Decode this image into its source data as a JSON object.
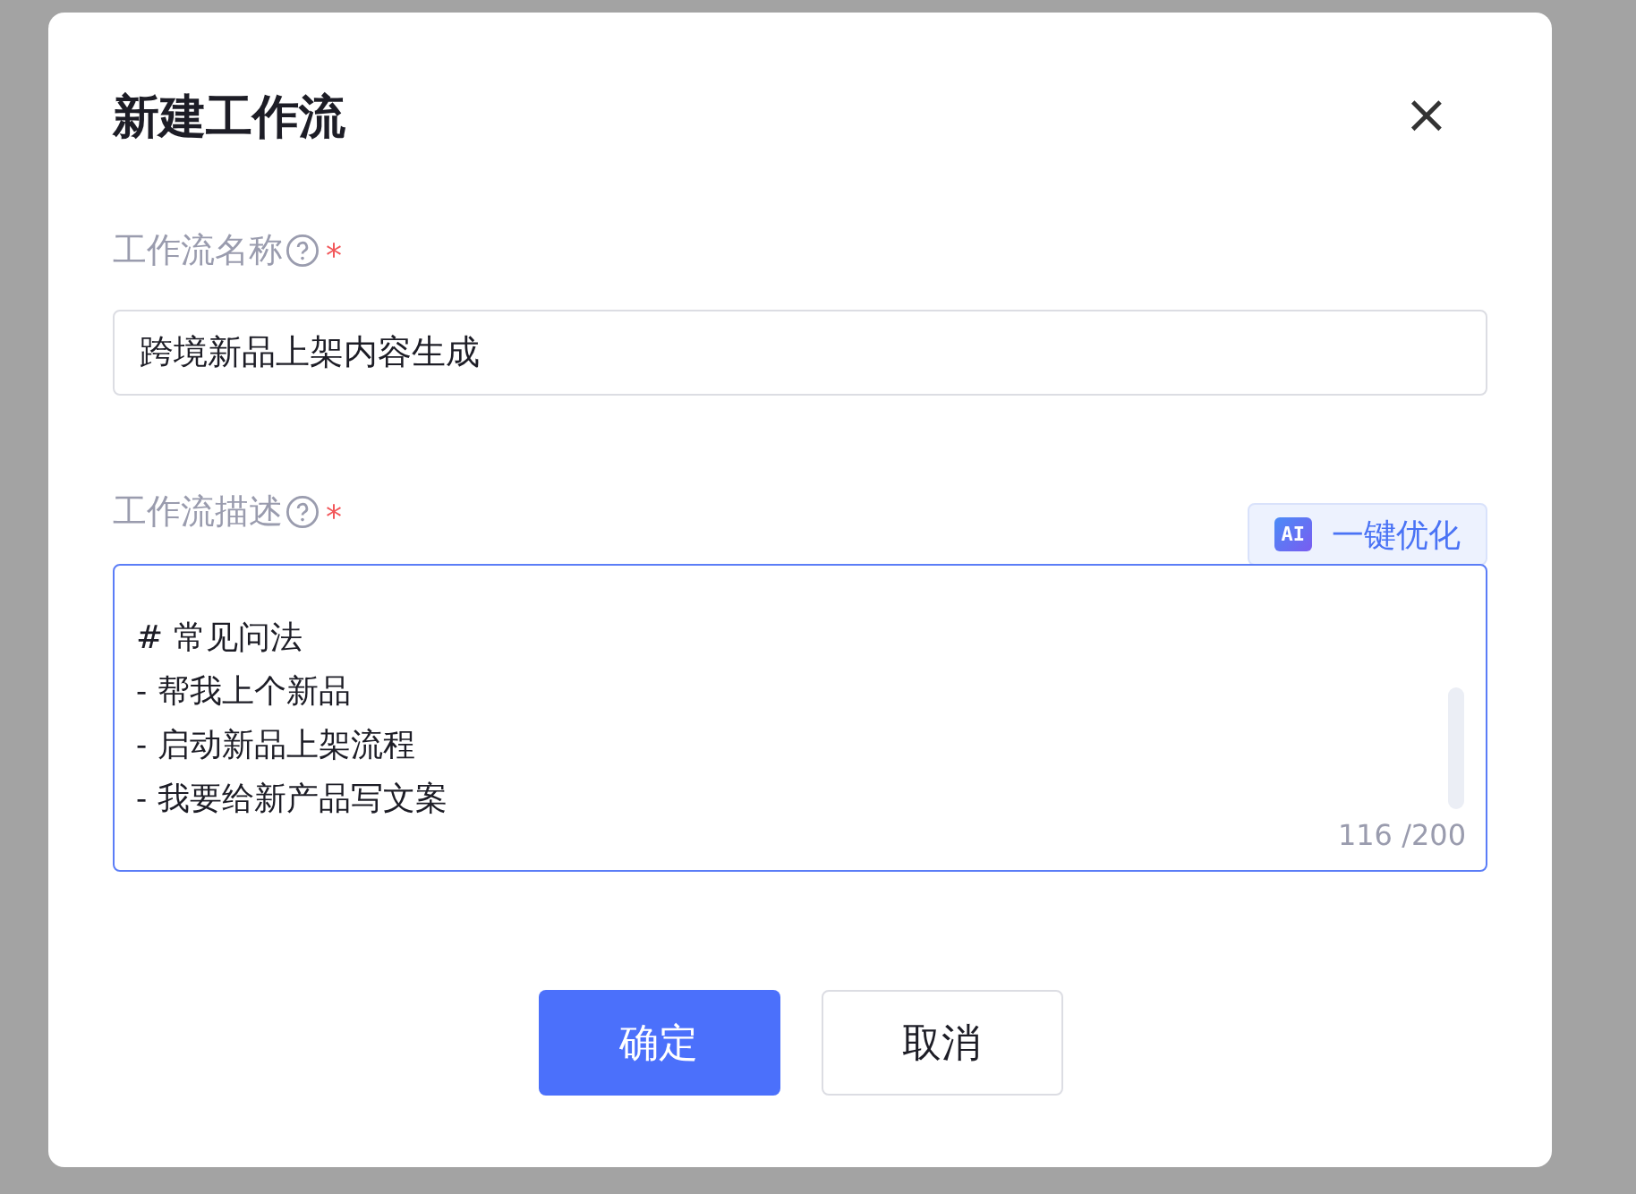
{
  "dialog": {
    "title": "新建工作流",
    "close": "×"
  },
  "name_field": {
    "label": "工作流名称",
    "required": "*",
    "value": "跨境新品上架内容生成"
  },
  "description_field": {
    "label": "工作流描述",
    "required": "*",
    "optimize_button": {
      "badge": "AI",
      "label": "一键优化"
    },
    "value_lines": [
      "# 常见问法",
      "- 帮我上个新品",
      "- 启动新品上架流程",
      "- 我要给新产品写文案"
    ],
    "counter": "116 /200",
    "focused": true
  },
  "buttons": [
    {
      "label": "确定",
      "kind": "primary"
    },
    {
      "label": "取消",
      "kind": "secondary"
    }
  ]
}
